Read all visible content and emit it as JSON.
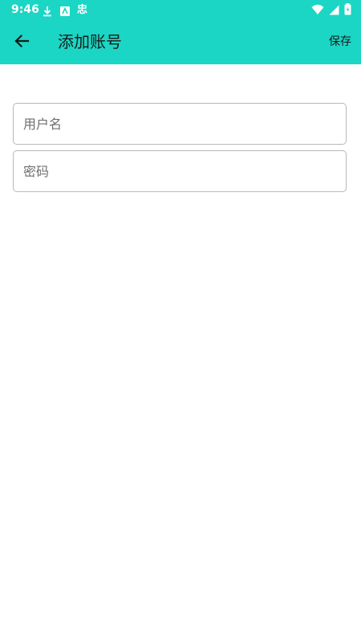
{
  "status_bar": {
    "time": "9:46",
    "notification_icons": [
      "download-icon",
      "app-notification-icon"
    ],
    "notification_text": "忠",
    "system_icons": [
      "wifi-icon",
      "cell-signal-icon",
      "battery-icon"
    ]
  },
  "toolbar": {
    "back_icon": "arrow-left-icon",
    "title": "添加账号",
    "save_label": "保存",
    "background_color": "#1BD6C4"
  },
  "form": {
    "username": {
      "placeholder": "用户名",
      "value": ""
    },
    "password": {
      "placeholder": "密码",
      "value": ""
    }
  }
}
